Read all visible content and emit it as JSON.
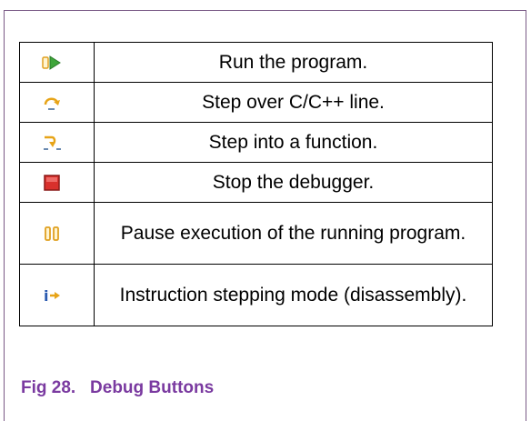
{
  "table": {
    "rows": [
      {
        "icon": "run-icon",
        "label": "Run the program."
      },
      {
        "icon": "step-over-icon",
        "label": "Step over C/C++ line."
      },
      {
        "icon": "step-into-icon",
        "label": "Step into a function."
      },
      {
        "icon": "stop-icon",
        "label": "Stop the debugger."
      },
      {
        "icon": "pause-icon",
        "label": "Pause execution of the running program."
      },
      {
        "icon": "instruction-step-icon",
        "label": "Instruction stepping mode (disassembly)."
      }
    ]
  },
  "caption": {
    "number": "Fig 28.",
    "title": "Debug Buttons"
  },
  "colors": {
    "caption": "#7a3aa0",
    "frame": "#7a5a86",
    "run_green": "#3fa53a",
    "stop_red": "#d9302c",
    "pause_yellow": "#e7a418",
    "step_orange": "#e7a418"
  }
}
